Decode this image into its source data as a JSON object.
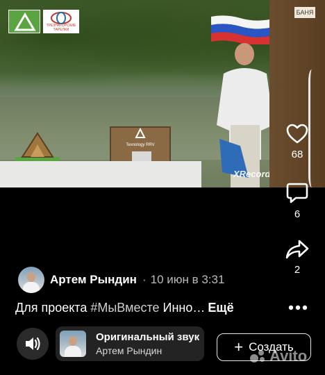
{
  "video": {
    "building_sign": "БАНЯ",
    "logo2_text": "ТРЕЗНАТОРСКИЕ ТАРЕЛКИ",
    "box_label": "Texnology  RRV",
    "watermark": "XRecorder"
  },
  "rail": {
    "likes": "68",
    "comments": "6",
    "shares": "2"
  },
  "author": {
    "name": "Артем Рындин",
    "separator": "·",
    "date": "10 июн в 3:31"
  },
  "description": {
    "prefix": "Для проекта ",
    "hashtag": "#МыВместе",
    "suffix": " Инно…",
    "more": "Ещё"
  },
  "sound": {
    "title": "Оригинальный звук",
    "author": "Артем Рындин"
  },
  "create": {
    "plus": "+",
    "label": "Создать"
  },
  "overlay": {
    "avito": "Avito"
  },
  "icons": {
    "like": "heart-icon",
    "comment": "comment-icon",
    "share": "share-icon",
    "more": "more-horizontal-icon",
    "sound": "speaker-icon"
  }
}
